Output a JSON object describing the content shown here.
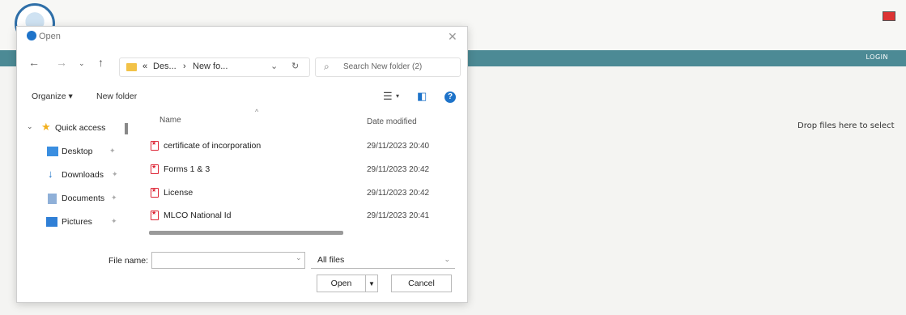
{
  "page": {
    "login_label": "LOGIN",
    "drop_text": "Drop files here to select"
  },
  "dialog": {
    "title": "Open",
    "nav": {
      "breadcrumb_prefix": "«",
      "breadcrumb_1": "Des...",
      "breadcrumb_sep": "›",
      "breadcrumb_2": "New fo...",
      "search_placeholder": "Search New folder (2)"
    },
    "toolbar": {
      "organize_label": "Organize ▾",
      "new_folder_label": "New folder"
    },
    "sidebar": {
      "items": [
        {
          "label": "Quick access",
          "icon": "star-icon"
        },
        {
          "label": "Desktop",
          "icon": "desktop-icon"
        },
        {
          "label": "Downloads",
          "icon": "download-icon"
        },
        {
          "label": "Documents",
          "icon": "documents-icon"
        },
        {
          "label": "Pictures",
          "icon": "pictures-icon"
        }
      ]
    },
    "columns": {
      "name": "Name",
      "date_modified": "Date modified"
    },
    "files": [
      {
        "name": "certificate of incorporation",
        "date": "29/11/2023 20:40"
      },
      {
        "name": "Forms 1 & 3",
        "date": "29/11/2023 20:42"
      },
      {
        "name": "License",
        "date": "29/11/2023 20:42"
      },
      {
        "name": "MLCO National Id",
        "date": "29/11/2023 20:41"
      }
    ],
    "footer": {
      "file_name_label": "File name:",
      "file_name_value": "",
      "filter_label": "All files",
      "open_label": "Open",
      "cancel_label": "Cancel"
    }
  },
  "colors": {
    "header_bar": "#4c8a95",
    "accent_blue": "#1e73c9",
    "pdf_red": "#d23"
  }
}
